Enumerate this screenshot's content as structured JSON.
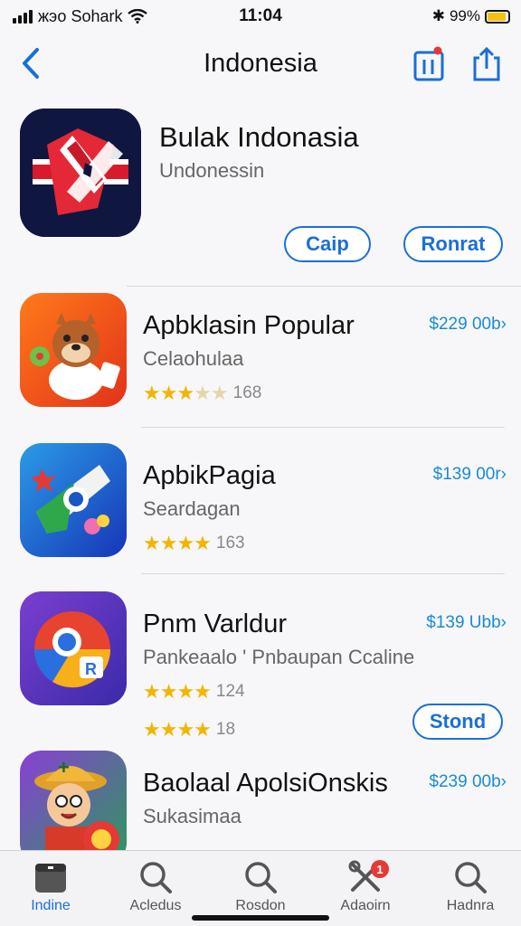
{
  "status": {
    "carrier": "жэо Sohark",
    "time": "11:04",
    "battery": "99%"
  },
  "nav": {
    "title": "Indonesia"
  },
  "featured": {
    "title": "Bulak Indonasia",
    "subtitle": "Undonessin",
    "button_primary": "Caip",
    "button_secondary": "Ronrat"
  },
  "apps": [
    {
      "name": "Apbklasin Popular",
      "subtitle": "Celaohulaa",
      "rating_count": "168",
      "price": "$229 00b›",
      "stars": 3
    },
    {
      "name": "ApbikPagia",
      "subtitle": "Seardagan",
      "rating_count": "163",
      "price": "$139 00r›",
      "stars": 4
    },
    {
      "name": "Pnm Varldur",
      "subtitle": "Pankeaalo ' Pnbaupan Ccaline",
      "rating_count": "124",
      "rating_count_2": "18",
      "price": "$139 Ubb›",
      "button": "Stond",
      "stars": 4
    },
    {
      "name": "Baolaal ApolsiOnskis",
      "subtitle": "Sukasimaa",
      "price": "$239 00b›"
    }
  ],
  "tabs": [
    {
      "label": "Indine",
      "icon": "today-icon"
    },
    {
      "label": "Acledus",
      "icon": "search-icon"
    },
    {
      "label": "Rosdon",
      "icon": "search-icon"
    },
    {
      "label": "Adaoirn",
      "icon": "tools-icon",
      "badge": "1"
    },
    {
      "label": "Hadnra",
      "icon": "search-icon"
    }
  ],
  "colors": {
    "accent": "#1a6fd6",
    "price": "#1a8ad6",
    "star": "#f4b400",
    "badge": "#e53935"
  }
}
